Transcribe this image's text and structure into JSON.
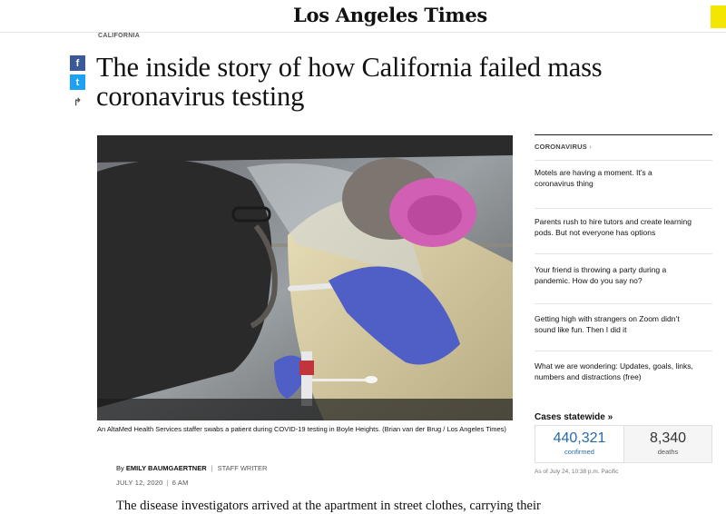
{
  "header": {
    "logo_text": "Los Angeles Times"
  },
  "article": {
    "section": "CALIFORNIA",
    "headline": "The inside story of how California failed mass coronavirus testing",
    "caption": "An AltaMed Health Services staffer swabs a patient during COVID-19 testing in Boyle Heights. (Brian van der Brug / Los Angeles Times)",
    "byline_prefix": "By",
    "author": "EMILY BAUMGAERTNER",
    "author_role": "STAFF WRITER",
    "date": "JULY 12, 2020",
    "time": "6 AM",
    "lede": "The disease investigators arrived at the apartment in street clothes, carrying their"
  },
  "share": {
    "facebook_glyph": "f",
    "twitter_glyph": "t",
    "share_glyph": "↱"
  },
  "sidebar": {
    "section_label": "CORONAVIRUS",
    "section_chevron": "›",
    "items": [
      {
        "title": "Motels are having a moment. It’s a coronavirus thing"
      },
      {
        "title": "Parents rush to hire tutors and create learning pods. But not everyone has options"
      },
      {
        "title": "Your friend is throwing a party during a pandemic. How do you say no?"
      },
      {
        "title": "Getting high with strangers on Zoom didn’t sound like fun. Then I did it"
      },
      {
        "title": "What we are wondering: Updates, goals, links, numbers and distractions (free)"
      }
    ]
  },
  "cases": {
    "title": "Cases statewide »",
    "confirmed_value": "440,321",
    "confirmed_label": "confirmed",
    "deaths_value": "8,340",
    "deaths_label": "deaths",
    "as_of": "As of July 24, 10:38 p.m. Pacific"
  },
  "icons": [
    "facebook-icon",
    "twitter-icon",
    "share-icon"
  ]
}
